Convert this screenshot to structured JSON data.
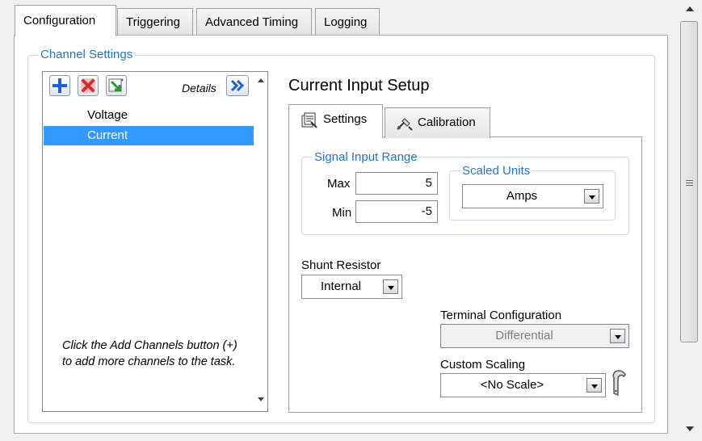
{
  "main_tabs": [
    {
      "label": "Configuration",
      "active": true
    },
    {
      "label": "Triggering",
      "active": false
    },
    {
      "label": "Advanced Timing",
      "active": false
    },
    {
      "label": "Logging",
      "active": false
    }
  ],
  "channel_settings": {
    "title": "Channel Settings",
    "details_label": "Details",
    "channels": [
      {
        "label": "Voltage",
        "selected": false
      },
      {
        "label": "Current",
        "selected": true
      }
    ],
    "hint": "Click the Add Channels button (+) to add more channels to the task."
  },
  "setup": {
    "title": "Current Input Setup",
    "tabs": [
      {
        "label": "Settings",
        "icon": "settings-icon",
        "active": true
      },
      {
        "label": "Calibration",
        "icon": "calibration-icon",
        "active": false
      }
    ],
    "signal_input_range": {
      "title": "Signal Input Range",
      "max_label": "Max",
      "max_value": "5",
      "min_label": "Min",
      "min_value": "-5"
    },
    "scaled_units": {
      "title": "Scaled Units",
      "value": "Amps"
    },
    "shunt_resistor": {
      "label": "Shunt Resistor",
      "value": "Internal"
    },
    "terminal_configuration": {
      "label": "Terminal Configuration",
      "value": "Differential",
      "disabled": true
    },
    "custom_scaling": {
      "label": "Custom Scaling",
      "value": "<No Scale>"
    }
  },
  "colors": {
    "group_title": "#1f75cc",
    "selection": "#3399ff",
    "add": "#1f5fd0",
    "remove": "#d42b2b"
  }
}
